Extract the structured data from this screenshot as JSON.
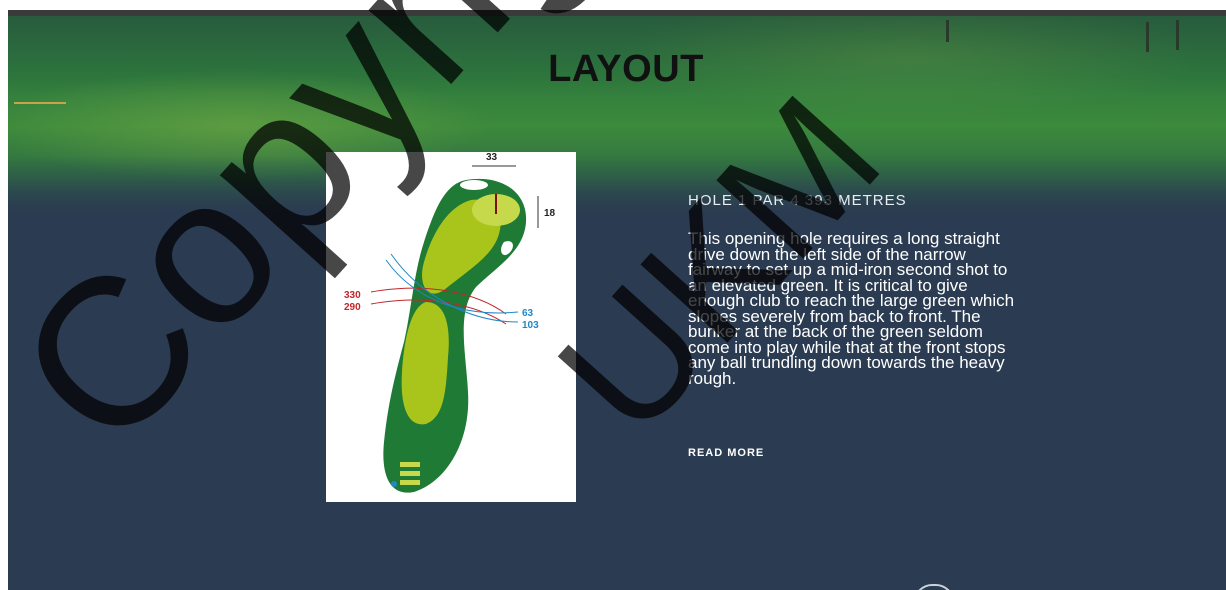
{
  "section": {
    "title": "LAYOUT"
  },
  "hole": {
    "label_prefix": "HOLE ",
    "number": "1",
    "details": " PAR 4 393 METRES",
    "description": "This opening hole requires a long straight drive down the left side of the narrow fairway to set up a mid-iron second shot to an elevated green. It is critical to give enough club to reach the large green which slopes severely from back to front. The bunker at the back of the green seldom come into play while that at the front stops any ball trundling down towards the heavy rough.",
    "read_more": "READ MORE"
  },
  "hole_map": {
    "green_width": "33",
    "green_depth": "18",
    "left_markers": [
      "330",
      "290"
    ],
    "right_markers": [
      "63",
      "103"
    ]
  },
  "watermark": {
    "line1": "Copyright",
    "line2": "UKM"
  },
  "colors": {
    "background": "#2b3b51",
    "accent": "#c9a24a",
    "red_marker": "#c0272d",
    "blue_marker": "#1e88c8"
  }
}
